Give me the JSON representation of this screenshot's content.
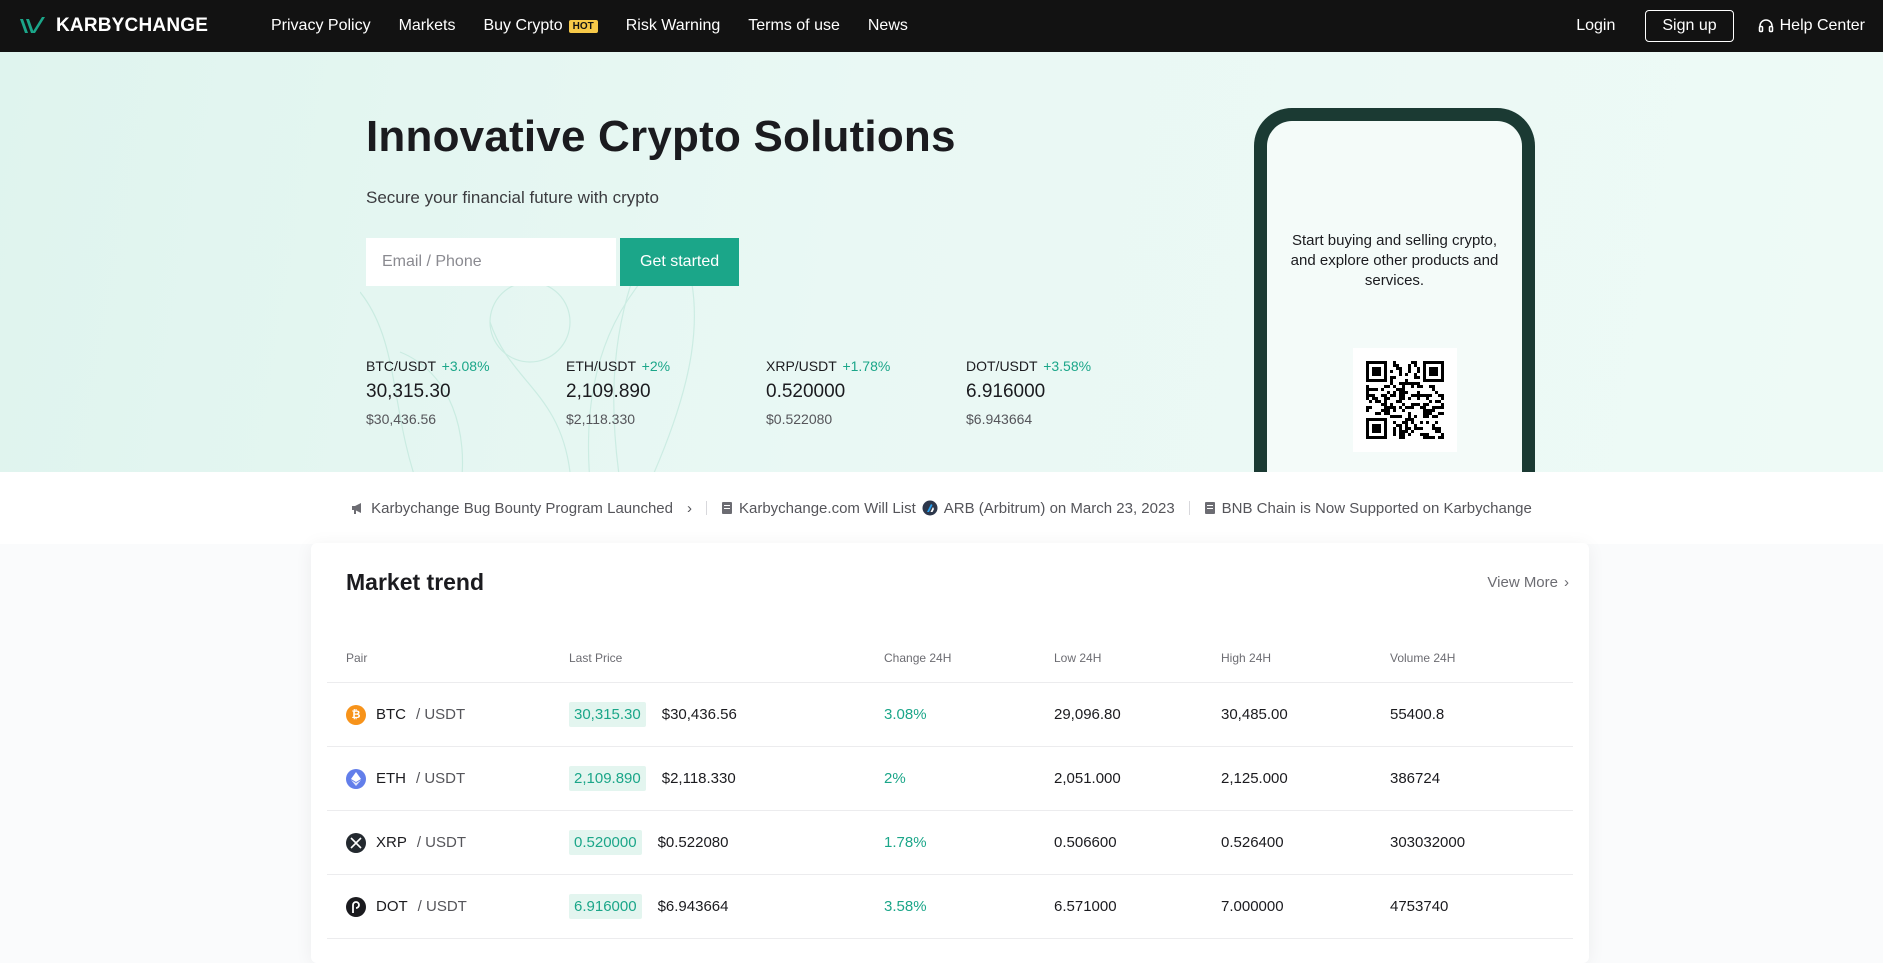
{
  "nav": {
    "brand": "KARBYCHANGE",
    "links": [
      "Privacy Policy",
      "Markets",
      "Buy Crypto",
      "Risk Warning",
      "Terms of use",
      "News"
    ],
    "hot_badge": "HOT",
    "login": "Login",
    "signup": "Sign up",
    "help": "Help Center"
  },
  "hero": {
    "title": "Innovative Crypto Solutions",
    "subtitle": "Secure your financial future with crypto",
    "email_placeholder": "Email / Phone",
    "cta": "Get started",
    "tickers": [
      {
        "pair": "BTC/USDT",
        "change": "+3.08%",
        "price": "30,315.30",
        "usd": "$30,436.56"
      },
      {
        "pair": "ETH/USDT",
        "change": "+2%",
        "price": "2,109.890",
        "usd": "$2,118.330"
      },
      {
        "pair": "XRP/USDT",
        "change": "+1.78%",
        "price": "0.520000",
        "usd": "$0.522080"
      },
      {
        "pair": "DOT/USDT",
        "change": "+3.58%",
        "price": "6.916000",
        "usd": "$6.943664"
      }
    ],
    "phone_text": "Start buying and selling crypto, and explore other products and services."
  },
  "announcements": {
    "a1": "Karbychange Bug Bounty Program Launched",
    "a2_pre": "Karbychange.com Will List",
    "a2_post": "ARB (Arbitrum) on March 23, 2023",
    "a3": "BNB Chain is Now Supported on Karbychange"
  },
  "market": {
    "title": "Market trend",
    "view_more": "View More",
    "headers": {
      "pair": "Pair",
      "last": "Last Price",
      "change": "Change 24H",
      "low": "Low 24H",
      "high": "High 24H",
      "volume": "Volume 24H"
    },
    "rows": [
      {
        "base": "BTC",
        "quote": "/ USDT",
        "price": "30,315.30",
        "usd": "$30,436.56",
        "change": "3.08%",
        "low": "29,096.80",
        "high": "30,485.00",
        "volume": "55400.8",
        "coin_color": "#f7931a",
        "coin_icon": "bitcoin-icon"
      },
      {
        "base": "ETH",
        "quote": "/ USDT",
        "price": "2,109.890",
        "usd": "$2,118.330",
        "change": "2%",
        "low": "2,051.000",
        "high": "2,125.000",
        "volume": "386724",
        "coin_color": "#627eea",
        "coin_icon": "ethereum-icon"
      },
      {
        "base": "XRP",
        "quote": "/ USDT",
        "price": "0.520000",
        "usd": "$0.522080",
        "change": "1.78%",
        "low": "0.506600",
        "high": "0.526400",
        "volume": "303032000",
        "coin_color": "#23292f",
        "coin_icon": "xrp-icon"
      },
      {
        "base": "DOT",
        "quote": "/ USDT",
        "price": "6.916000",
        "usd": "$6.943664",
        "change": "3.58%",
        "low": "6.571000",
        "high": "7.000000",
        "volume": "4753740",
        "coin_color": "#1b1b1f",
        "coin_icon": "polkadot-icon"
      }
    ]
  },
  "colors": {
    "accent": "#1ba689",
    "nav_bg": "#121212",
    "hot": "#f7c948"
  }
}
